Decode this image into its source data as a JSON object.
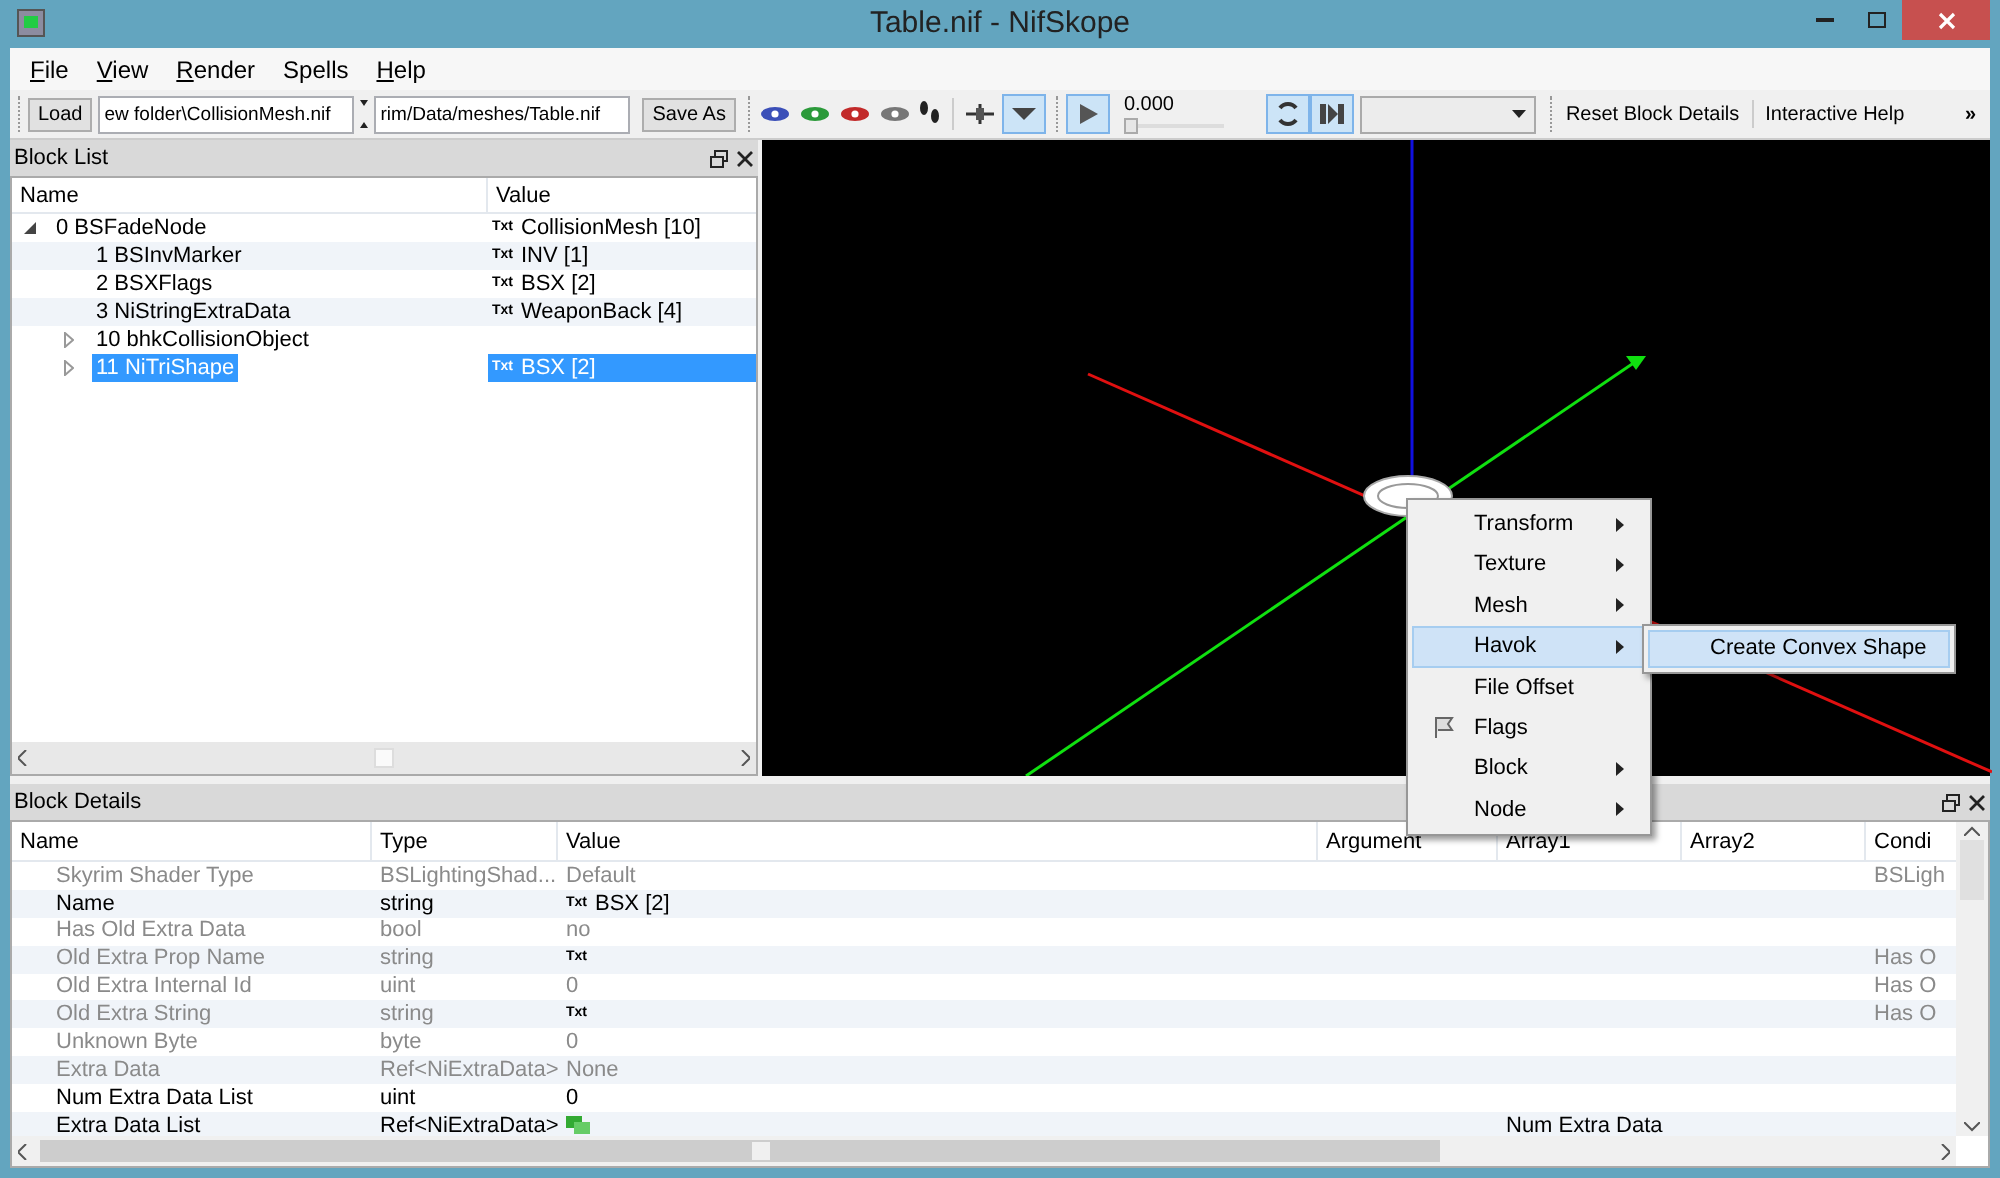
{
  "window": {
    "title": "Table.nif - NifSkope"
  },
  "menu": [
    {
      "label": "File",
      "mnemonic": true
    },
    {
      "label": "View",
      "mnemonic": true
    },
    {
      "label": "Render",
      "mnemonic": true
    },
    {
      "label": "Spells",
      "mnemonic": false
    },
    {
      "label": "Help",
      "mnemonic": true
    }
  ],
  "toolbar": {
    "load": "Load",
    "path_1": "ew folder\\CollisionMesh.nif",
    "path_2": "rim/Data/meshes/Table.nif",
    "save_as": "Save As",
    "time": "0.000",
    "time_slider": {
      "level": 0
    },
    "animation_toggles": [
      {
        "kind": "play",
        "on": true
      },
      {
        "kind": "loop",
        "on": true
      },
      {
        "kind": "switch",
        "on": true
      }
    ],
    "view_dropdown_on": true,
    "reset": "Reset Block Details",
    "help": "Interactive Help",
    "more": "»"
  },
  "block_list": {
    "title": "Block List",
    "columns": [
      "Name",
      "Value"
    ],
    "tree": [
      {
        "name": "0 BSFadeNode",
        "tag": "Txt",
        "value": "CollisionMesh [10]",
        "expanded": true,
        "selected": false,
        "children": [
          {
            "name": "1 BSInvMarker",
            "tag": "Txt",
            "value": "INV [1]",
            "selected": false
          },
          {
            "name": "2 BSXFlags",
            "tag": "Txt",
            "value": "BSX [2]",
            "selected": false
          },
          {
            "name": "3 NiStringExtraData",
            "tag": "Txt",
            "value": "WeaponBack [4]",
            "selected": false
          },
          {
            "name": "10 bhkCollisionObject",
            "expanded": false,
            "selected": false
          },
          {
            "name": "11 NiTriShape",
            "tag": "Txt",
            "value": "BSX [2]",
            "expanded": false,
            "selected": true
          }
        ]
      }
    ]
  },
  "context_menu": [
    {
      "label": "Transform",
      "kind": "submenu",
      "selected": false
    },
    {
      "label": "Texture",
      "kind": "submenu",
      "selected": false
    },
    {
      "label": "Mesh",
      "kind": "submenu",
      "selected": false
    },
    {
      "label": "Havok",
      "kind": "submenu",
      "selected": true
    },
    {
      "label": "File Offset",
      "kind": "action",
      "selected": false
    },
    {
      "label": "Flags",
      "kind": "flag",
      "selected": false
    },
    {
      "label": "Block",
      "kind": "submenu",
      "selected": false
    },
    {
      "label": "Node",
      "kind": "submenu",
      "selected": false
    }
  ],
  "submenu": [
    {
      "label": "Create Convex Shape",
      "selected": true
    }
  ],
  "block_details": {
    "title": "Block Details",
    "columns": [
      "Name",
      "Type",
      "Value",
      "Argument",
      "Array1",
      "Array2",
      "Condi"
    ],
    "rows": [
      {
        "name": "Skyrim Shader Type",
        "type": "BSLightingShad...",
        "value": "Default",
        "condition": "BSLigh",
        "disabled": true
      },
      {
        "name": "Name",
        "type": "string",
        "tag": "Txt",
        "value": "BSX [2]",
        "disabled": false
      },
      {
        "name": "Has Old Extra Data",
        "type": "bool",
        "value": "no",
        "disabled": true
      },
      {
        "name": "Old Extra Prop Name",
        "type": "string",
        "tag": "Txt",
        "condition": "Has O",
        "disabled": true
      },
      {
        "name": "Old Extra Internal Id",
        "type": "uint",
        "value": "0",
        "condition": "Has O",
        "disabled": true
      },
      {
        "name": "Old Extra String",
        "type": "string",
        "tag": "Txt",
        "condition": "Has O",
        "disabled": true
      },
      {
        "name": "Unknown Byte",
        "type": "byte",
        "value": "0",
        "disabled": true
      },
      {
        "name": "Extra Data",
        "type": "Ref<NiExtraData>",
        "value": "None",
        "disabled": true
      },
      {
        "name": "Num Extra Data List",
        "type": "uint",
        "value": "0",
        "disabled": false
      },
      {
        "name": "Extra Data List",
        "type": "Ref<NiExtraData>",
        "kind": "array",
        "array1": "Num Extra Data",
        "disabled": false
      }
    ]
  }
}
